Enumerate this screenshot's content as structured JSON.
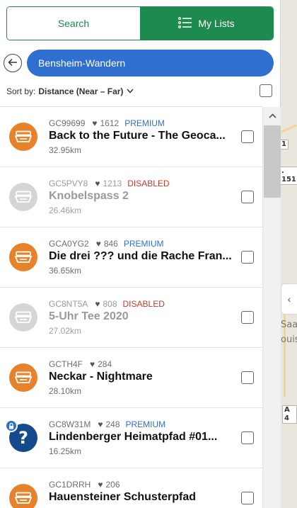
{
  "tabs": {
    "search_label": "Search",
    "lists_label": "My Lists"
  },
  "list": {
    "name": "Bensheim-Wandern"
  },
  "sort": {
    "label": "Sort by:",
    "value": "Distance (Near – Far)"
  },
  "map": {
    "road_1": "1",
    "road_151": ". 151",
    "road_a4": "A 4",
    "town_1": "Saa",
    "town_2": "ouis"
  },
  "colors": {
    "primary_green": "#1d8a4f",
    "pill_blue": "#2f6fd0",
    "traditional_orange": "#e8822a",
    "disabled_gray": "#d5d5d5",
    "mystery_blue": "#134b8c",
    "premium_text": "#2f6fd0",
    "disabled_text": "#c53a2a"
  },
  "caches": [
    {
      "code": "GC99699",
      "favorites": "1612",
      "status": "PREMIUM",
      "status_type": "premium",
      "title": "Back to the Future - The Geoca...",
      "distance": "32.95km",
      "icon": "traditional-cache-icon",
      "icon_color": "orange",
      "dim": false,
      "premium_badge": false
    },
    {
      "code": "GC5PVY8",
      "favorites": "1213",
      "status": "DISABLED",
      "status_type": "disabled",
      "title": "Knobelspass 2",
      "distance": "26.46km",
      "icon": "traditional-cache-icon",
      "icon_color": "gray",
      "dim": true,
      "premium_badge": false
    },
    {
      "code": "GCA0YG2",
      "favorites": "846",
      "status": "PREMIUM",
      "status_type": "premium",
      "title": "Die drei ??? und die Rache Fran...",
      "distance": "36.65km",
      "icon": "traditional-cache-icon",
      "icon_color": "orange",
      "dim": false,
      "premium_badge": false
    },
    {
      "code": "GC8NT5A",
      "favorites": "808",
      "status": "DISABLED",
      "status_type": "disabled",
      "title": "5-Uhr Tee 2020",
      "distance": "27.02km",
      "icon": "traditional-cache-icon",
      "icon_color": "gray",
      "dim": true,
      "premium_badge": false
    },
    {
      "code": "GCTH4F",
      "favorites": "284",
      "status": "",
      "status_type": "",
      "title": "Neckar - Nightmare",
      "distance": "28.10km",
      "icon": "traditional-cache-icon",
      "icon_color": "orange",
      "dim": false,
      "premium_badge": false
    },
    {
      "code": "GC8W31M",
      "favorites": "248",
      "status": "PREMIUM",
      "status_type": "premium",
      "title": "Lindenberger Heimatpfad #01...",
      "distance": "16.25km",
      "icon": "mystery-cache-icon",
      "icon_color": "blue",
      "dim": false,
      "premium_badge": true
    },
    {
      "code": "GC1DRRH",
      "favorites": "206",
      "status": "",
      "status_type": "",
      "title": "Hauensteiner Schusterpfad",
      "distance": "",
      "icon": "traditional-cache-icon",
      "icon_color": "orange",
      "dim": false,
      "premium_badge": false
    }
  ]
}
